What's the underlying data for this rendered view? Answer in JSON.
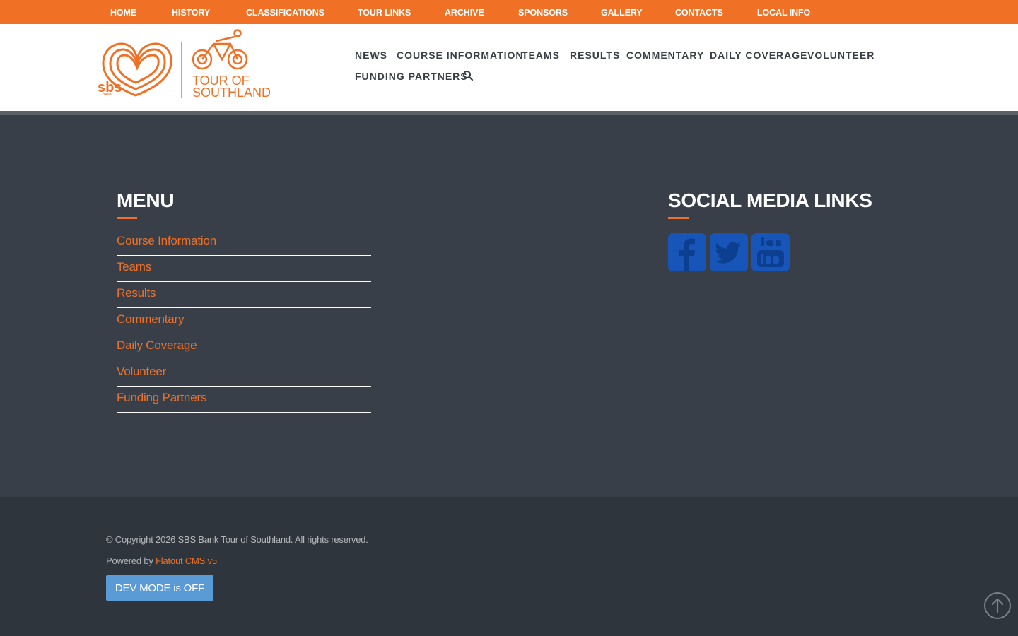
{
  "topnav": {
    "items": [
      "HOME",
      "HISTORY",
      "CLASSIFICATIONS",
      "TOUR LINKS",
      "ARCHIVE",
      "SPONSORS",
      "GALLERY",
      "CONTACTS",
      "LOCAL INFO"
    ]
  },
  "logo": {
    "bank_text": "sbs",
    "bank_sub": "BANK",
    "line1": "TOUR OF",
    "line2": "SOUTHLAND"
  },
  "mainnav": {
    "items": [
      "NEWS",
      "COURSE INFORMATION",
      "TEAMS",
      "RESULTS",
      "COMMENTARY",
      "DAILY COVERAGE",
      "VOLUNTEER",
      "FUNDING PARTNERS"
    ],
    "search_icon": "search-icon"
  },
  "footer_menu": {
    "title": "MENU",
    "items": [
      "Course Information",
      "Teams",
      "Results",
      "Commentary",
      "Daily Coverage",
      "Volunteer",
      "Funding Partners"
    ]
  },
  "social": {
    "title": "SOCIAL MEDIA LINKS",
    "icons": [
      "facebook-icon",
      "twitter-icon",
      "youtube-icon"
    ]
  },
  "bottom": {
    "copyright": "© Copyright 2026 SBS Bank Tour of Southland. All rights reserved.",
    "powered_prefix": "Powered by ",
    "powered_link": "Flatout CMS v5",
    "dev_button": "DEV MODE is OFF"
  },
  "colors": {
    "accent": "#f07126",
    "dark": "#383f48",
    "darker": "#2f353d",
    "social": "#1756b8",
    "button": "#5b9bd5"
  }
}
